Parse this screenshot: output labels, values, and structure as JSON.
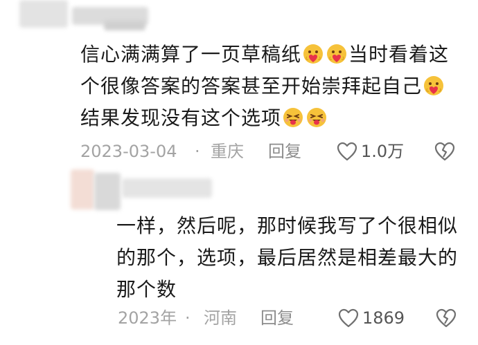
{
  "comments": [
    {
      "text_lines": [
        [
          "信心满满算了一页草稿纸",
          "[heart-face]",
          "[heart-face]",
          "当时看着这"
        ],
        [
          "个很像答案的答案甚至开始崇拜起自己",
          "[heart-face]"
        ],
        [
          "结果发现没有这个选项",
          "[tongue-face]",
          "[tongue-face]"
        ]
      ],
      "line1_a": "信心满满算了一页草稿纸",
      "line1_b": "当时看着这",
      "line2_a": "个很像答案的答案甚至开始崇拜起自己",
      "line3_a": "结果发现没有这个选项",
      "date": "2023-03-04",
      "separator": "·",
      "location": "重庆",
      "reply_label": "回复",
      "like_count": "1.0万"
    },
    {
      "line1": "一样，然后呢，那时候我写了个很相似",
      "line2": "的那个，选项，最后居然是相差最大的",
      "line3": "那个数",
      "date": "2023年",
      "separator": "·",
      "location": "河南",
      "reply_label": "回复",
      "like_count": "1869"
    }
  ],
  "colors": {
    "text": "#1a1a1a",
    "meta": "#a3a3a3",
    "reply": "#8c8c8c",
    "count": "#555555"
  },
  "icons": {
    "like": "heart-outline-icon",
    "dislike": "broken-heart-icon",
    "emoji_love": "heart-face-emoji",
    "emoji_tongue": "tongue-wink-emoji"
  }
}
